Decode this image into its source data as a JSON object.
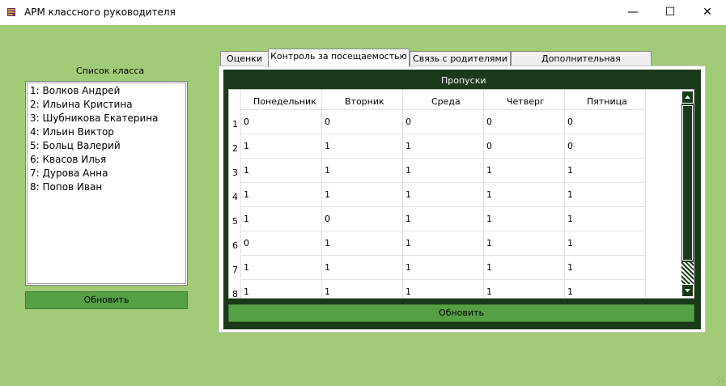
{
  "window": {
    "title": "АРМ классного руководителя",
    "minimize_icon": "—",
    "maximize_icon": "☐",
    "close_icon": "✕"
  },
  "class_list": {
    "label": "Список класса",
    "students": [
      "1:  Волков Андрей",
      "2:  Ильина Кристина",
      "3:  Шубникова Екатерина",
      "4:  Ильин Виктор",
      "5:  Больц Валерий",
      "6:  Квасов Илья",
      "7:  Дурова Анна",
      "8:  Попов Иван"
    ],
    "refresh_label": "Обновить"
  },
  "tabs": [
    {
      "label": "Оценки"
    },
    {
      "label": "Контроль за посещаемостью"
    },
    {
      "label": "Связь с родителями"
    },
    {
      "label": "Дополнительная информация"
    }
  ],
  "active_tab": 1,
  "attendance": {
    "title": "Пропуски",
    "columns": [
      "Понедельник",
      "Вторник",
      "Среда",
      "Четверг",
      "Пятница"
    ],
    "rows": [
      {
        "num": "1",
        "values": [
          "0",
          "0",
          "0",
          "0",
          "0"
        ]
      },
      {
        "num": "2",
        "values": [
          "1",
          "1",
          "1",
          "0",
          "0"
        ]
      },
      {
        "num": "3",
        "values": [
          "1",
          "1",
          "1",
          "1",
          "1"
        ]
      },
      {
        "num": "4",
        "values": [
          "1",
          "1",
          "1",
          "1",
          "1"
        ]
      },
      {
        "num": "5",
        "values": [
          "1",
          "0",
          "1",
          "1",
          "1"
        ]
      },
      {
        "num": "6",
        "values": [
          "0",
          "1",
          "1",
          "1",
          "1"
        ]
      },
      {
        "num": "7",
        "values": [
          "1",
          "1",
          "1",
          "1",
          "1"
        ]
      },
      {
        "num": "8",
        "values": [
          "1",
          "1",
          "1",
          "1",
          "1"
        ]
      }
    ],
    "refresh_label": "Обновить"
  },
  "colors": {
    "background": "#a2cb78",
    "button": "#55a045",
    "panel": "#1a3a1a"
  }
}
